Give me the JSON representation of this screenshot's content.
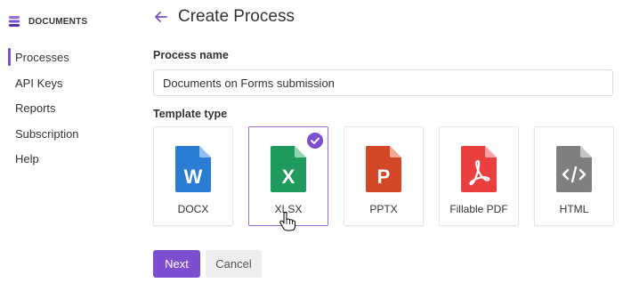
{
  "sidebar": {
    "brand": "DOCUMENTS",
    "items": [
      {
        "label": "Processes",
        "active": true
      },
      {
        "label": "API Keys"
      },
      {
        "label": "Reports"
      },
      {
        "label": "Subscription"
      },
      {
        "label": "Help"
      }
    ]
  },
  "header": {
    "title": "Create Process",
    "back_icon": "arrow-left-icon"
  },
  "form": {
    "name_label": "Process name",
    "name_value": "Documents on Forms submission",
    "type_label": "Template type",
    "templates": [
      {
        "label": "DOCX",
        "letter": "W",
        "color": "#2b7cd3",
        "icon": "word-document-icon"
      },
      {
        "label": "XLSX",
        "letter": "X",
        "color": "#1d9a5c",
        "icon": "excel-document-icon",
        "selected": true
      },
      {
        "label": "PPTX",
        "letter": "P",
        "color": "#d24726",
        "icon": "powerpoint-document-icon"
      },
      {
        "label": "Fillable PDF",
        "color": "#e9403f",
        "icon": "pdf-document-icon"
      },
      {
        "label": "HTML",
        "color": "#7f7f7f",
        "icon": "html-code-document-icon"
      }
    ]
  },
  "actions": {
    "next_label": "Next",
    "cancel_label": "Cancel"
  },
  "colors": {
    "accent": "#7d4fd0",
    "selected_border": "#9b6ad6"
  }
}
